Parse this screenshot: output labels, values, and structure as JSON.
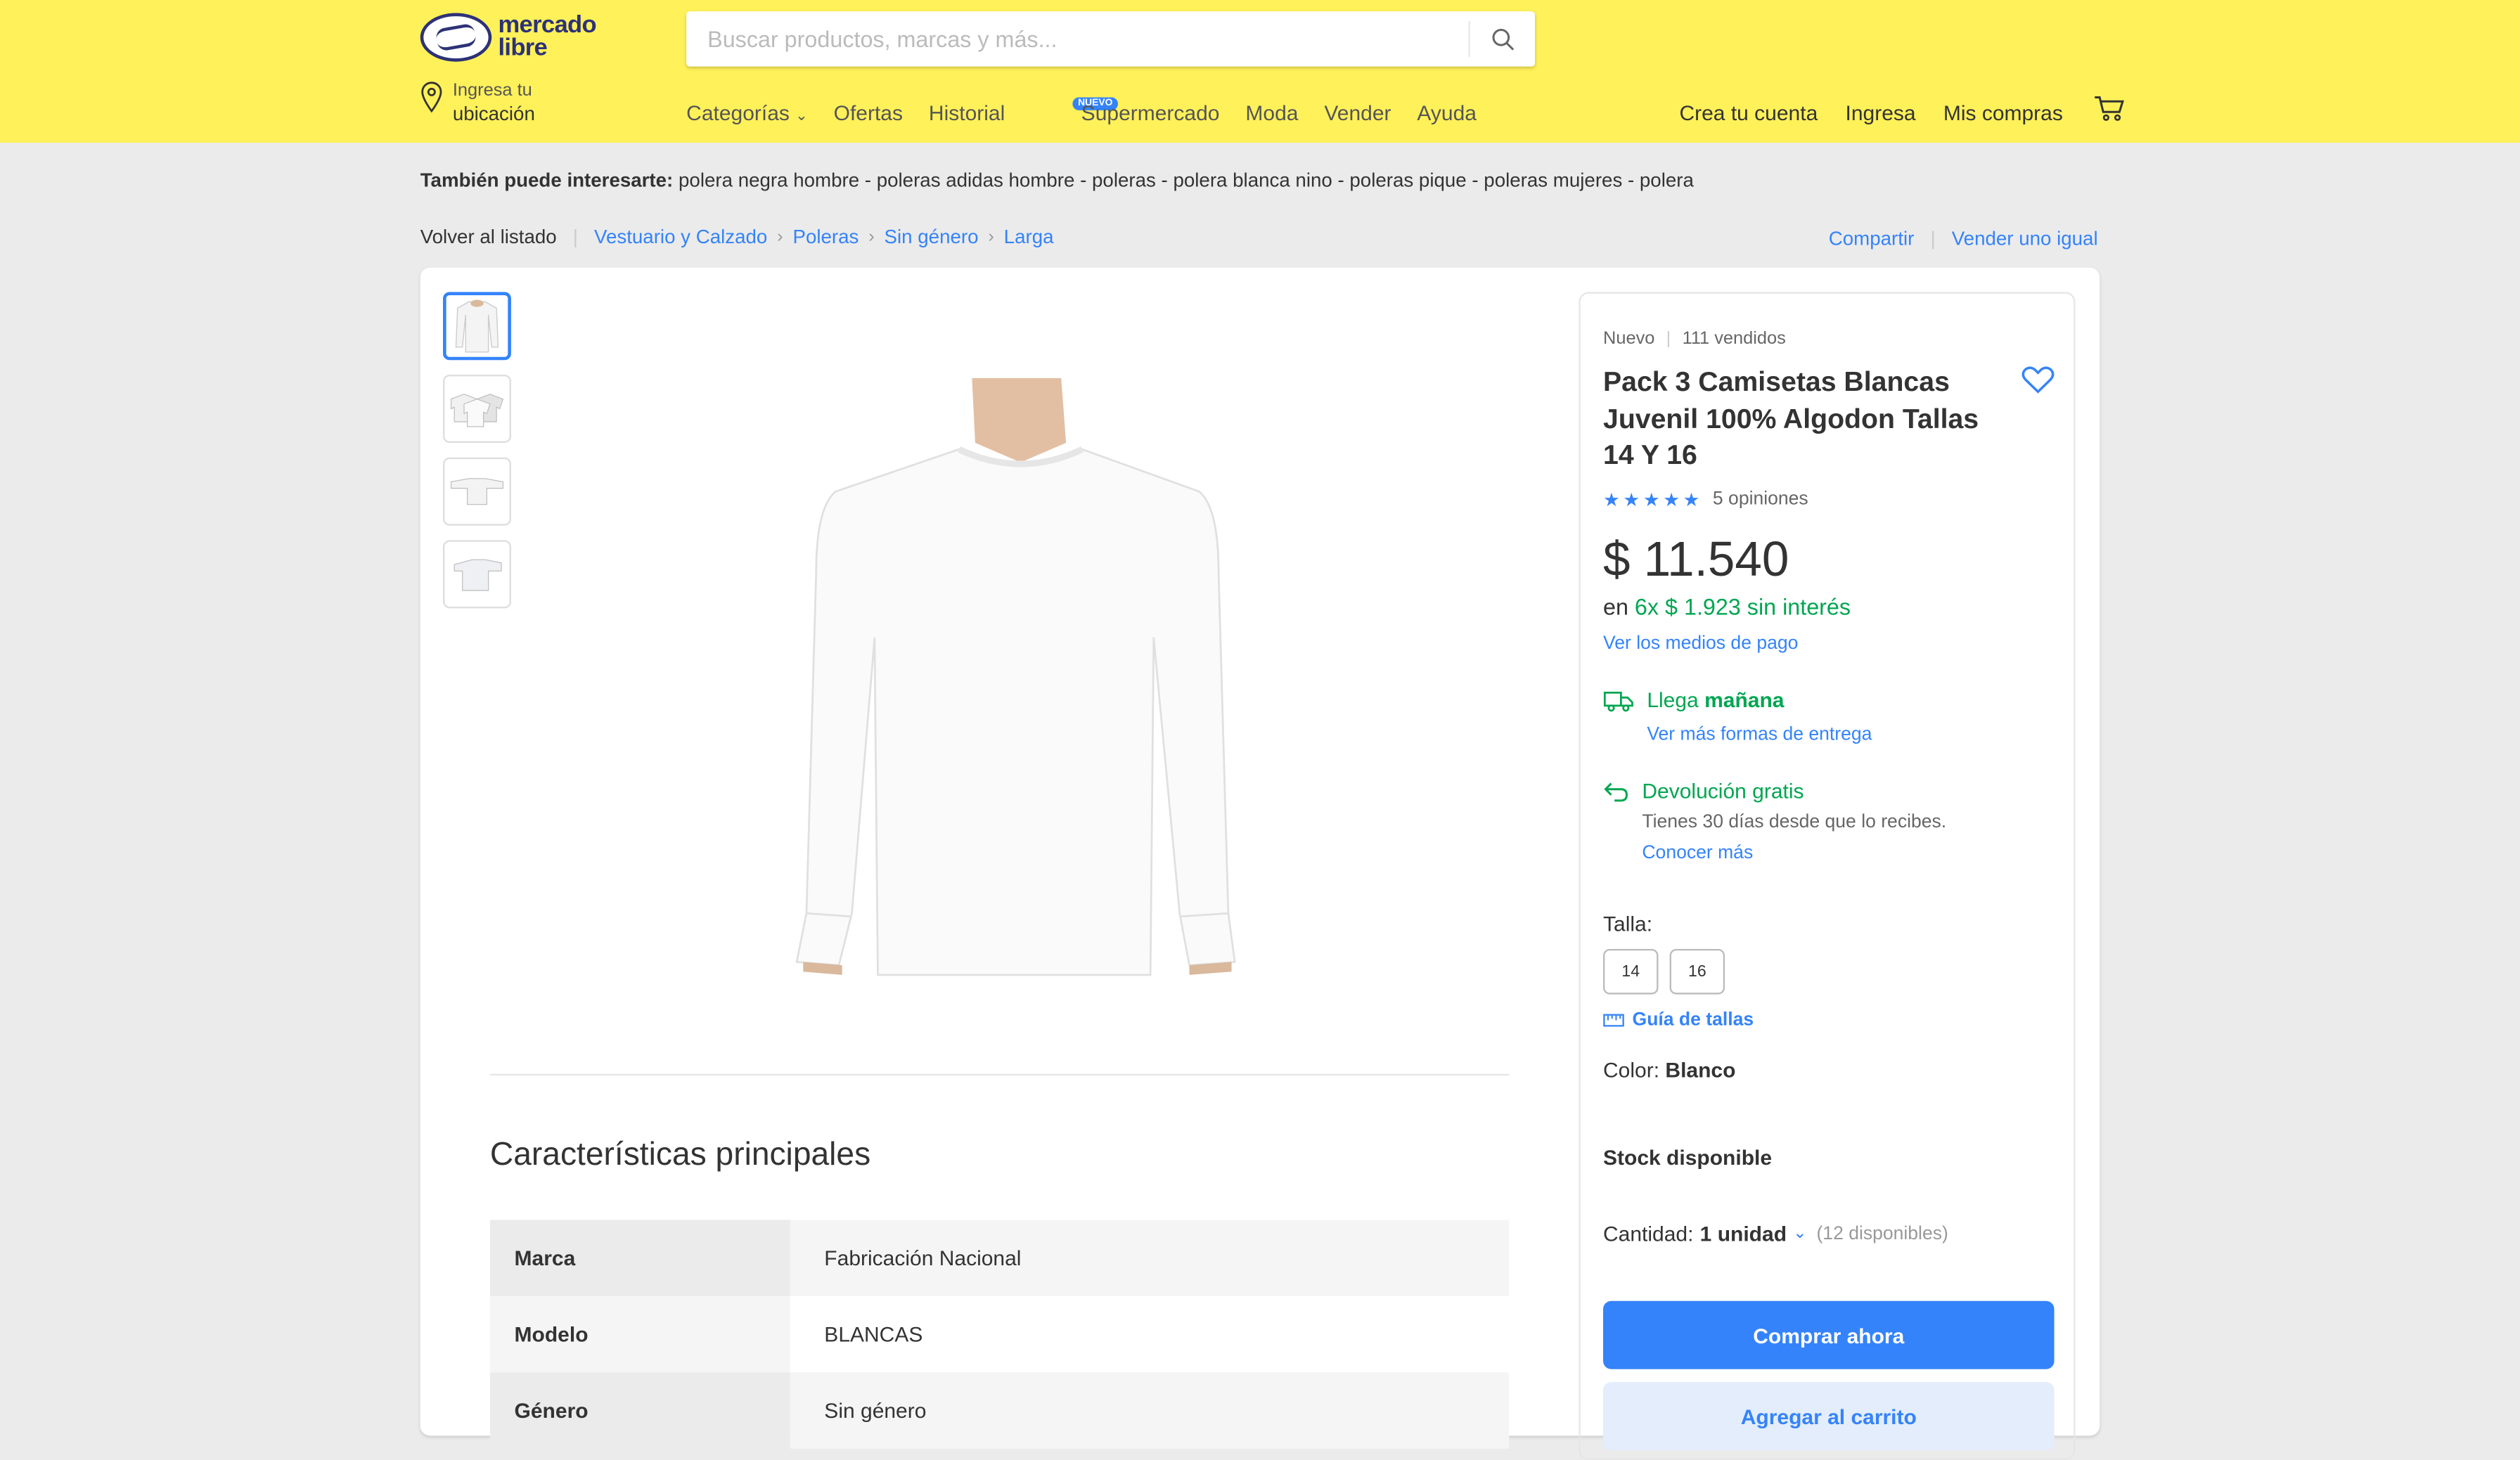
{
  "header": {
    "logo_line1": "mercado",
    "logo_line2": "libre",
    "search_placeholder": "Buscar productos, marcas y más...",
    "location_line1": "Ingresa tu",
    "location_line2": "ubicación",
    "nav": [
      "Categorías",
      "Ofertas",
      "Historial",
      "Supermercado",
      "Moda",
      "Vender",
      "Ayuda"
    ],
    "nuevo_badge": "NUEVO",
    "right_nav": [
      "Crea tu cuenta",
      "Ingresa",
      "Mis compras"
    ],
    "accent": "#fff159"
  },
  "interest": {
    "label": "También puede interesarte:",
    "text": "polera negra hombre - poleras adidas hombre - poleras - polera blanca nino - poleras pique - poleras mujeres - polera"
  },
  "breadcrumb": {
    "back": "Volver al listado",
    "items": [
      "Vestuario y Calzado",
      "Poleras",
      "Sin género",
      "Larga"
    ],
    "share": "Compartir",
    "sell_same": "Vender uno igual"
  },
  "product": {
    "condition": "Nuevo",
    "sold": "111 vendidos",
    "title": "Pack 3 Camisetas Blancas Juvenil 100% Algodon Tallas 14 Y 16",
    "rating_stars": 5,
    "opinions": "5 opiniones",
    "price": "$ 11.540",
    "installments_prefix": "en",
    "installments": "6x $ 1.923 sin interés",
    "payment_link": "Ver los medios de pago",
    "shipping_prefix": "Llega",
    "shipping_day": "mañana",
    "shipping_link": "Ver más formas de entrega",
    "return_title": "Devolución gratis",
    "return_desc": "Tienes 30 días desde que lo recibes.",
    "return_link": "Conocer más",
    "size_label": "Talla:",
    "sizes": [
      "14",
      "16"
    ],
    "size_guide": "Guía de tallas",
    "color_label": "Color:",
    "color_value": "Blanco",
    "stock": "Stock disponible",
    "qty_label": "Cantidad:",
    "qty_value": "1 unidad",
    "qty_available": "(12 disponibles)",
    "buy_now": "Comprar ahora",
    "add_cart": "Agregar al carrito",
    "accent": "#3483fa",
    "green": "#00a650"
  },
  "features": {
    "title": "Características principales",
    "rows": [
      {
        "key": "Marca",
        "value": "Fabricación Nacional"
      },
      {
        "key": "Modelo",
        "value": "BLANCAS"
      },
      {
        "key": "Género",
        "value": "Sin género"
      }
    ]
  }
}
